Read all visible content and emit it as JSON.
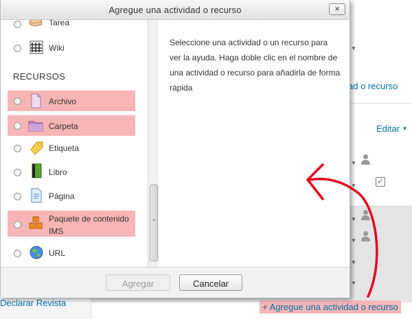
{
  "dialog": {
    "title": "Agregue una actividad o recurso",
    "close_label": "×",
    "help_text": "Seleccione una actividad o un recurso para ver la ayuda. Haga doble clic en el nombre de una actividad o recurso para añadirla de forma rápida",
    "section_resources": "RECURSOS",
    "activities": [
      {
        "label": "Tarea",
        "icon": "assignment-icon"
      },
      {
        "label": "Wiki",
        "icon": "wiki-icon"
      }
    ],
    "resources": [
      {
        "label": "Archivo",
        "icon": "file-icon",
        "highlighted": true
      },
      {
        "label": "Carpeta",
        "icon": "folder-icon",
        "highlighted": true
      },
      {
        "label": "Etiqueta",
        "icon": "label-tag-icon",
        "highlighted": false
      },
      {
        "label": "Libro",
        "icon": "book-icon",
        "highlighted": false
      },
      {
        "label": "Página",
        "icon": "page-icon",
        "highlighted": false
      },
      {
        "label_line1": "Paquete de contenido",
        "label_line2": "IMS",
        "icon": "ims-package-icon",
        "highlighted": true
      },
      {
        "label": "URL",
        "icon": "url-globe-icon",
        "highlighted": false
      }
    ],
    "buttons": {
      "add": "Agregar",
      "cancel": "Cancelar"
    }
  },
  "background": {
    "right_link": "ad o recurso",
    "edit_menu": "Editar",
    "left_link": "Declarar Revista",
    "add_activity_link": "Agregue una actividad o recurso"
  },
  "colors": {
    "highlight": "#f7b5b5",
    "link": "#0070a8",
    "arrow": "#e3001b"
  }
}
